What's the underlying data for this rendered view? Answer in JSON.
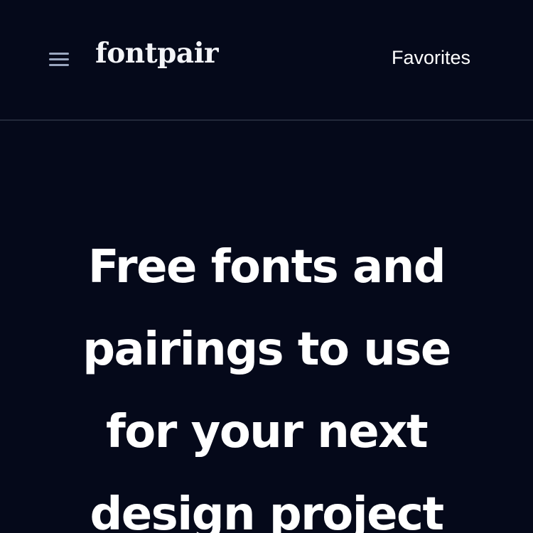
{
  "header": {
    "menu_icon": "hamburger-menu-icon",
    "logo_text": "fontpair",
    "nav_favorites": "Favorites"
  },
  "hero": {
    "title": "Free fonts and pairings to use for your next design project"
  },
  "colors": {
    "background": "#05091a",
    "divider": "#23293a",
    "menu_icon": "#9aa6bf",
    "text": "#ffffff"
  }
}
